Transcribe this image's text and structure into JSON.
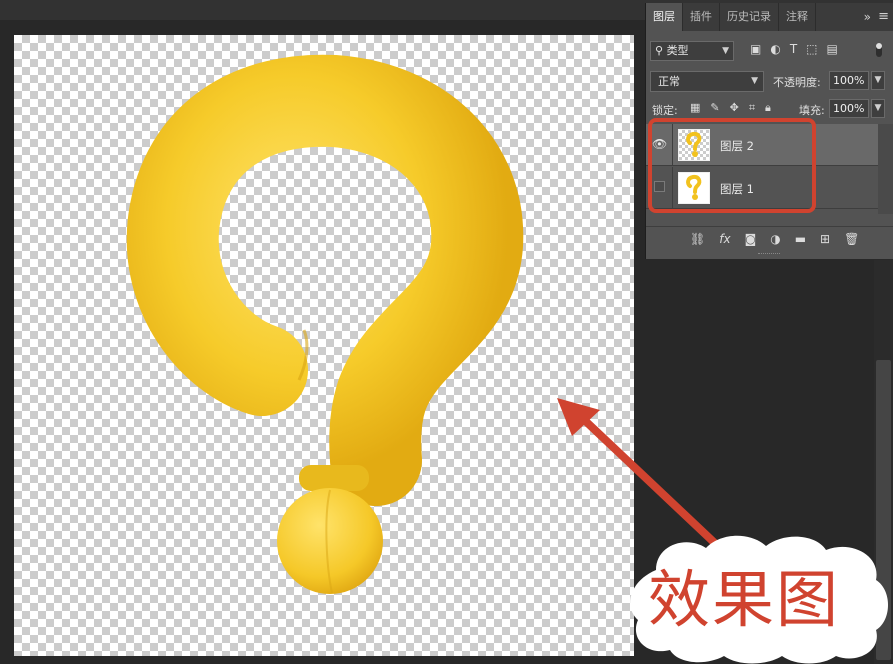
{
  "panel": {
    "tabs": [
      {
        "label": "图层",
        "active": true
      },
      {
        "label": "插件",
        "active": false
      },
      {
        "label": "历史记录",
        "active": false
      },
      {
        "label": "注释",
        "active": false
      }
    ],
    "more_label": "»",
    "menu_label": "≡",
    "filter": {
      "icon": "search-icon",
      "value": "类型"
    },
    "blend_mode": "正常",
    "opacity_label": "不透明度:",
    "opacity_value": "100%",
    "lock_label": "锁定:",
    "fill_label": "填充:",
    "fill_value": "100%"
  },
  "layers": [
    {
      "name": "图层 2",
      "visible": true,
      "selected": true,
      "thumbnail": "question-mark-transparent"
    },
    {
      "name": "图层 1",
      "visible": false,
      "selected": false,
      "thumbnail": "question-mark-white"
    }
  ],
  "bottom_icons": [
    "link-icon",
    "fx-icon",
    "mask-icon",
    "adjustment-icon",
    "folder-icon",
    "new-layer-icon",
    "trash-icon"
  ],
  "annotation": {
    "label": "效果图",
    "color": "#d0432f"
  },
  "accent": {
    "question_mark": "#f5cf2e",
    "highlight_red": "#d0432f"
  }
}
